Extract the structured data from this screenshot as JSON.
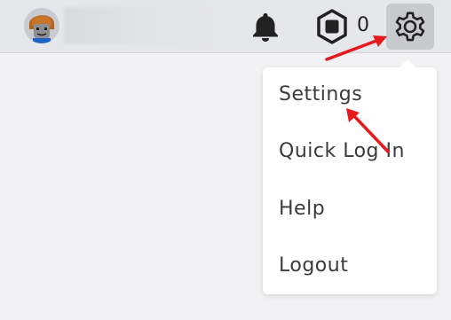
{
  "header": {
    "robux_count": "0",
    "icons": {
      "notifications": "bell-icon",
      "currency": "robux-icon",
      "settings": "gear-icon"
    }
  },
  "settings_menu": {
    "items": [
      {
        "label": "Settings"
      },
      {
        "label": "Quick Log In"
      },
      {
        "label": "Help"
      },
      {
        "label": "Logout"
      }
    ]
  },
  "colors": {
    "header_bg": "#e6e7ea",
    "page_bg": "#f2f2f4",
    "gear_active_bg": "#c9cacd",
    "menu_text": "#393b3d",
    "annotation_arrow": "#e8191d"
  }
}
